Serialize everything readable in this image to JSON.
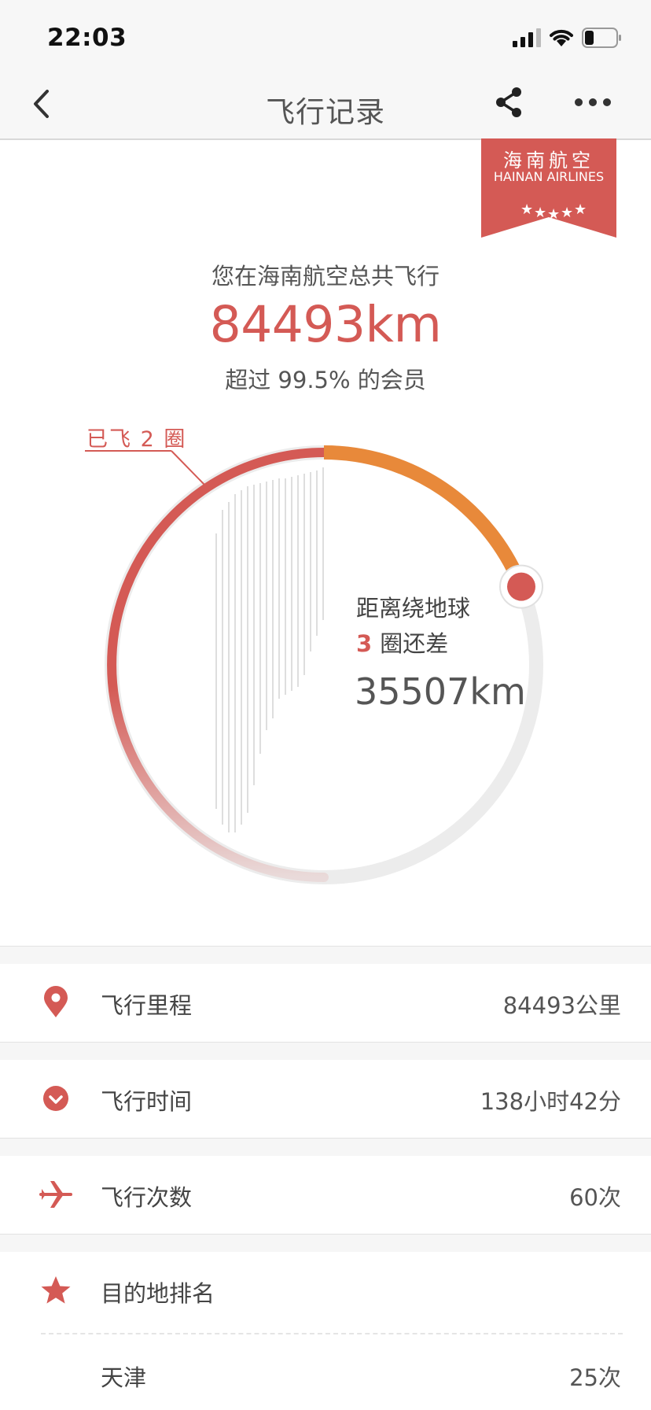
{
  "status_bar": {
    "time": "22:03"
  },
  "nav": {
    "title": "飞行记录",
    "back_icon": "chevron-left-icon",
    "share_icon": "share-icon",
    "more_icon": "more-icon"
  },
  "badge": {
    "cn": "海南航空",
    "en": "HAINAN AIRLINES",
    "color": "#d45a55"
  },
  "summary": {
    "label": "您在海南航空总共飞行",
    "total_km": "84493km",
    "percentile": "超过 99.5% 的会员"
  },
  "globe": {
    "laps_label": "已飞 2 圈",
    "remain_line1": "距离绕地球",
    "remain_laps": "3",
    "remain_line2": "圈还差",
    "remain_km": "35507km",
    "progress_fraction": 0.19
  },
  "colors": {
    "accent": "#d45a55",
    "progress": "#e8893a",
    "track": "#ececec"
  },
  "stats": [
    {
      "icon": "location-pin-icon",
      "label": "飞行里程",
      "value": "84493公里"
    },
    {
      "icon": "clock-icon",
      "label": "飞行时间",
      "value": "138小时42分"
    },
    {
      "icon": "airplane-icon",
      "label": "飞行次数",
      "value": "60次"
    }
  ],
  "ranking": {
    "icon": "star-icon",
    "label": "目的地排名",
    "items": [
      {
        "city": "天津",
        "count": "25次"
      }
    ]
  }
}
